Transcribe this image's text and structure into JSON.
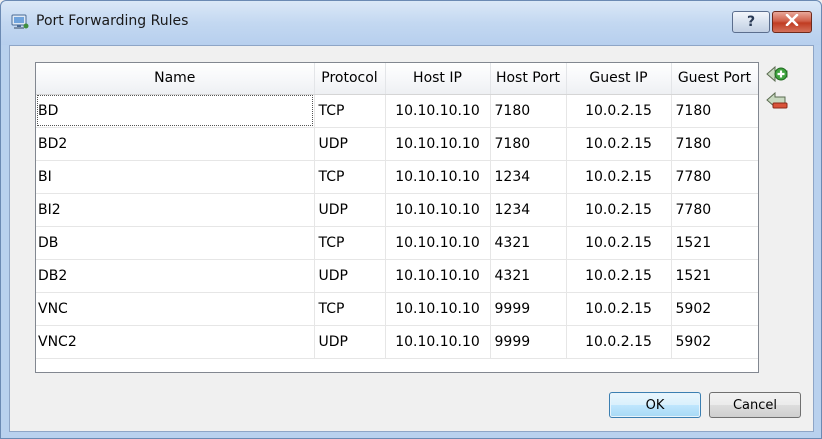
{
  "window": {
    "title": "Port Forwarding Rules",
    "help_label": "?"
  },
  "table": {
    "columns": [
      "Name",
      "Protocol",
      "Host IP",
      "Host Port",
      "Guest IP",
      "Guest Port"
    ],
    "rows": [
      {
        "name": "BD",
        "protocol": "TCP",
        "host_ip": "10.10.10.10",
        "host_port": "7180",
        "guest_ip": "10.0.2.15",
        "guest_port": "7180"
      },
      {
        "name": "BD2",
        "protocol": "UDP",
        "host_ip": "10.10.10.10",
        "host_port": "7180",
        "guest_ip": "10.0.2.15",
        "guest_port": "7180"
      },
      {
        "name": "BI",
        "protocol": "TCP",
        "host_ip": "10.10.10.10",
        "host_port": "1234",
        "guest_ip": "10.0.2.15",
        "guest_port": "7780"
      },
      {
        "name": "BI2",
        "protocol": "UDP",
        "host_ip": "10.10.10.10",
        "host_port": "1234",
        "guest_ip": "10.0.2.15",
        "guest_port": "7780"
      },
      {
        "name": "DB",
        "protocol": "TCP",
        "host_ip": "10.10.10.10",
        "host_port": "4321",
        "guest_ip": "10.0.2.15",
        "guest_port": "1521"
      },
      {
        "name": "DB2",
        "protocol": "UDP",
        "host_ip": "10.10.10.10",
        "host_port": "4321",
        "guest_ip": "10.0.2.15",
        "guest_port": "1521"
      },
      {
        "name": "VNC",
        "protocol": "TCP",
        "host_ip": "10.10.10.10",
        "host_port": "9999",
        "guest_ip": "10.0.2.15",
        "guest_port": "5902"
      },
      {
        "name": "VNC2",
        "protocol": "UDP",
        "host_ip": "10.10.10.10",
        "host_port": "9999",
        "guest_ip": "10.0.2.15",
        "guest_port": "5902"
      }
    ]
  },
  "buttons": {
    "ok_label": "OK",
    "cancel_label": "Cancel"
  },
  "icons": {
    "window": "network-window-icon",
    "add": "add-rule-icon",
    "remove": "remove-rule-icon",
    "close": "close-icon"
  }
}
